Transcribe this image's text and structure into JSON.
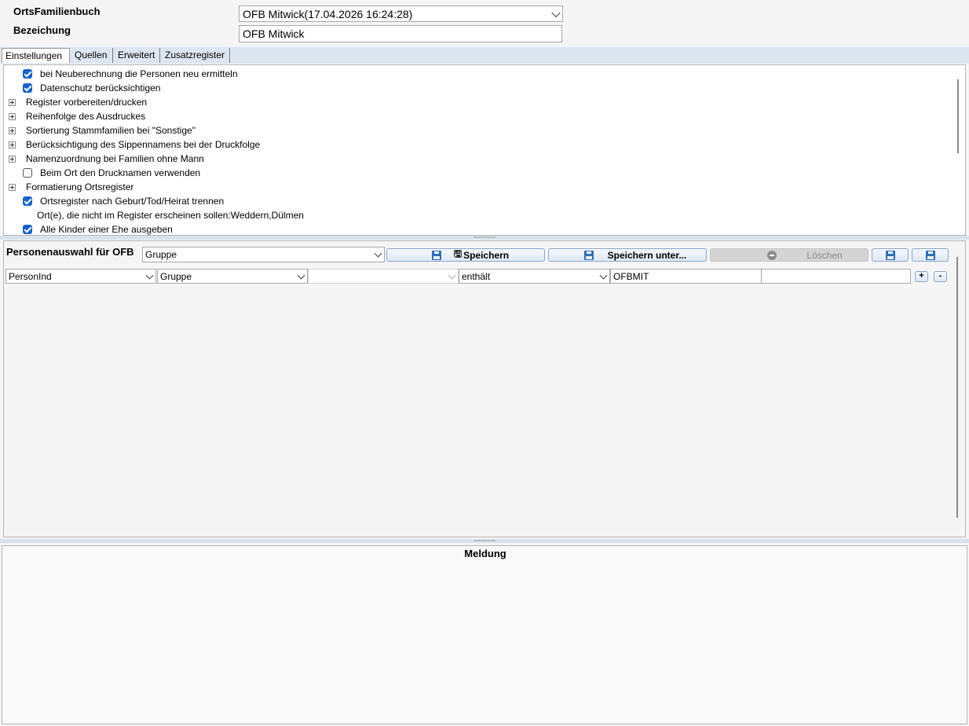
{
  "header": {
    "ofb_label": "OrtsFamilienbuch",
    "ofb_value": "OFB Mitwick(17.04.2026 16:24:28)",
    "bezeichnung_label": "Bezeichung",
    "bezeichnung_value": "OFB Mitwick"
  },
  "tabs": [
    {
      "label": "Einstellungen",
      "active": true
    },
    {
      "label": "Quellen",
      "active": false
    },
    {
      "label": "Erweitert",
      "active": false
    },
    {
      "label": "Zusatzregister",
      "active": false
    }
  ],
  "settings": [
    {
      "type": "checkbox",
      "checked": true,
      "label": "bei Neuberechnung die Personen neu ermitteln"
    },
    {
      "type": "checkbox",
      "checked": true,
      "label": "Datenschutz berücksichtigen"
    },
    {
      "type": "group",
      "label": "Register vorbereiten/drucken"
    },
    {
      "type": "group",
      "label": "Reihenfolge des Ausdruckes"
    },
    {
      "type": "group",
      "label": "Sortierung Stammfamilien bei \"Sonstige\""
    },
    {
      "type": "group",
      "label": "Berücksichtigung des Sippennamens bei der Druckfolge"
    },
    {
      "type": "group",
      "label": "Namenzuordnung bei Familien ohne Mann"
    },
    {
      "type": "checkbox",
      "checked": false,
      "label": "Beim Ort den Drucknamen verwenden"
    },
    {
      "type": "group",
      "label": "Formatierung Ortsregister"
    },
    {
      "type": "checkbox",
      "checked": true,
      "label": "Ortsregister nach Geburt/Tod/Heirat trennen"
    },
    {
      "type": "text",
      "label": "Ort(e), die nicht im Register erscheinen sollen:Weddern,Dülmen"
    },
    {
      "type": "checkbox",
      "checked": true,
      "label": "Alle Kinder einer Ehe ausgeben"
    }
  ],
  "selection": {
    "title": "Personenauswahl für OFB",
    "group_value": "Gruppe",
    "save_label": "Speichern",
    "save_as_label": "Speichern unter...",
    "delete_label": "Löschen"
  },
  "filter": {
    "field": "PersonInd",
    "attribute": "Gruppe",
    "empty": "",
    "operator": "enthält",
    "value": "OFBMIT",
    "add_label": "+",
    "remove_label": "-"
  },
  "message": {
    "title": "Meldung"
  },
  "colors": {
    "checkbox": "#1a62c4",
    "tabbar": "#dde6f0",
    "splitter": "#d8e2ec"
  }
}
